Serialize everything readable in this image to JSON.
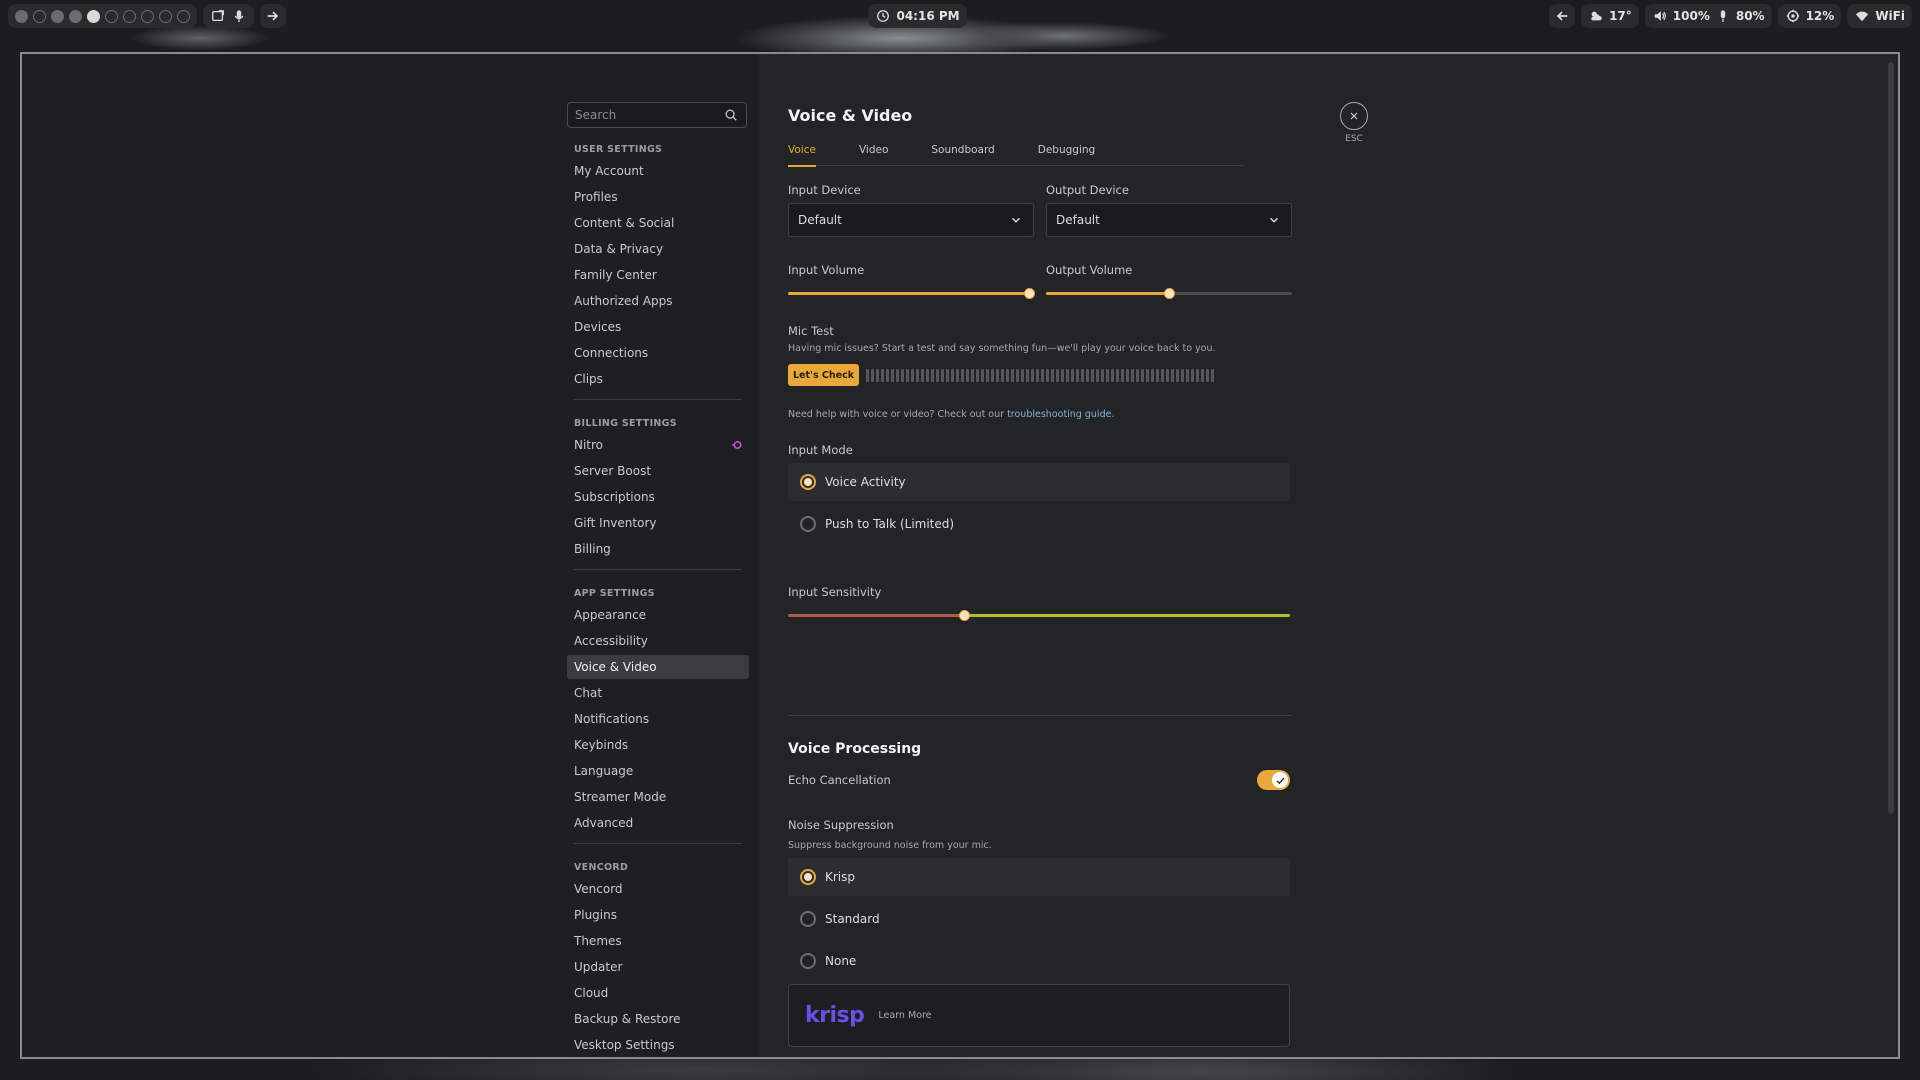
{
  "topbar": {
    "time": "04:16 PM",
    "weather": "17°",
    "volume": "100%",
    "mic": "80%",
    "cpu": "12%",
    "wifi": "WiFi",
    "workspaces": [
      "filled",
      "empty",
      "filled",
      "filled",
      "active",
      "empty",
      "empty",
      "empty",
      "empty",
      "empty"
    ]
  },
  "sidebar": {
    "search_placeholder": "Search",
    "sections": [
      {
        "header": "USER SETTINGS",
        "items": [
          "My Account",
          "Profiles",
          "Content & Social",
          "Data & Privacy",
          "Family Center",
          "Authorized Apps",
          "Devices",
          "Connections",
          "Clips"
        ]
      },
      {
        "header": "BILLING SETTINGS",
        "items": [
          "Nitro",
          "Server Boost",
          "Subscriptions",
          "Gift Inventory",
          "Billing"
        ]
      },
      {
        "header": "APP SETTINGS",
        "items": [
          "Appearance",
          "Accessibility",
          "Voice & Video",
          "Chat",
          "Notifications",
          "Keybinds",
          "Language",
          "Streamer Mode",
          "Advanced"
        ]
      },
      {
        "header": "VENCORD",
        "items": [
          "Vencord",
          "Plugins",
          "Themes",
          "Updater",
          "Cloud",
          "Backup & Restore",
          "Vesktop Settings"
        ]
      }
    ],
    "selected": "Voice & Video"
  },
  "content": {
    "title": "Voice & Video",
    "tabs": [
      "Voice",
      "Video",
      "Soundboard",
      "Debugging"
    ],
    "active_tab": "Voice",
    "input_device_label": "Input Device",
    "input_device_value": "Default",
    "output_device_label": "Output Device",
    "output_device_value": "Default",
    "input_volume_label": "Input Volume",
    "input_volume_value": 0.98,
    "output_volume_label": "Output Volume",
    "output_volume_value": 0.5,
    "mic_test_label": "Mic Test",
    "mic_test_desc": "Having mic issues? Start a test and say something fun—we'll play your voice back to you.",
    "lets_check": "Let's Check",
    "help_text": "Need help with voice or video? Check out our ",
    "help_link": "troubleshooting guide.",
    "input_mode_label": "Input Mode",
    "input_modes": [
      "Voice Activity",
      "Push to Talk (Limited)"
    ],
    "input_mode_selected": 0,
    "input_sensitivity_label": "Input Sensitivity",
    "input_sensitivity_value": 0.35,
    "voice_processing_title": "Voice Processing",
    "echo_cancellation_label": "Echo Cancellation",
    "echo_cancellation_on": true,
    "noise_suppression_label": "Noise Suppression",
    "noise_suppression_desc": "Suppress background noise from your mic.",
    "noise_options": [
      "Krisp",
      "Standard",
      "None"
    ],
    "noise_selected": 0,
    "krisp_logo": "krisp",
    "learn_more": "Learn More",
    "esc": "ESC"
  },
  "colors": {
    "accent": "#e9a93a",
    "krisp": "#6a4ee8",
    "nitro": "#c84ed6"
  }
}
